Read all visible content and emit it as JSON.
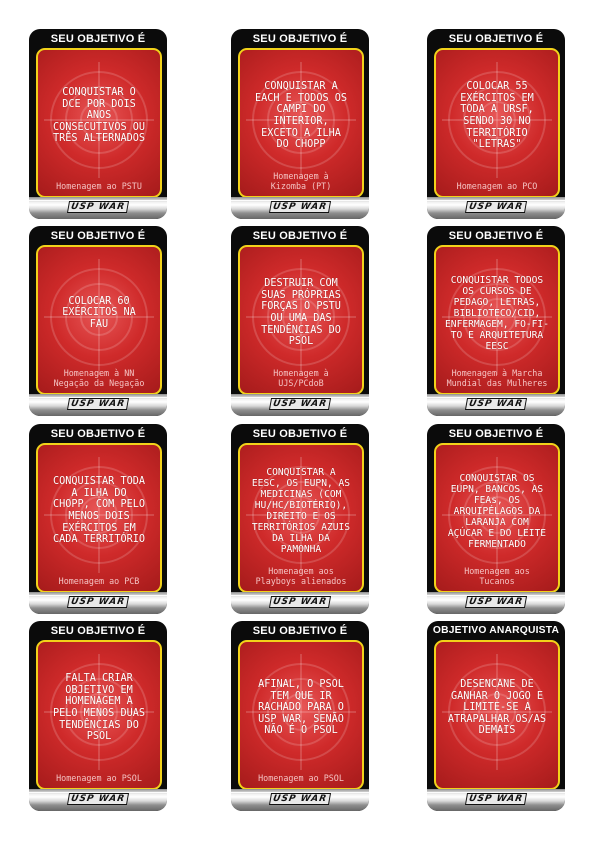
{
  "footer_logo": "USP WAR",
  "cards": [
    {
      "header": "SEU OBJETIVO É",
      "text": "CONQUISTAR O\nDCE POR DOIS\nANOS\nCONSECUTIVOS OU\nTRÊS ALTERNADOS",
      "credit": "Homenagem ao PSTU"
    },
    {
      "header": "SEU OBJETIVO É",
      "text": "CONQUISTAR A\nEACH E TODOS OS\nCAMPI DO\nINTERIOR,\nEXCETO A ILHA\nDO CHOPP",
      "credit": "Homenagem à\nKizomba (PT)"
    },
    {
      "header": "SEU OBJETIVO É",
      "text": "COLOCAR 55\nEXÉRCITOS EM\nTODA A URSF,\nSENDO 30 NO\nTERRITÓRIO\n\"LETRAS\"",
      "credit": "Homenagem ao PCO"
    },
    {
      "header": "SEU OBJETIVO É",
      "text": "COLOCAR 60\nEXÉRCITOS NA\nFAU",
      "credit": "Homenagem à NN\nNegação da Negação"
    },
    {
      "header": "SEU OBJETIVO É",
      "text": "DESTRUIR COM\nSUAS PRÓPRIAS\nFORÇAS O PSTU\nOU UMA DAS\nTENDÊNCIAS DO\nPSOL",
      "credit": "Homenagem à\nUJS/PCdoB"
    },
    {
      "header": "SEU OBJETIVO É",
      "text": "CONQUISTAR TODOS\nOS CURSOS DE\nPEDAGO, LETRAS,\nBIBLIOTECO/CID,\nENFERMAGEM, FO-FI-\nTO E ARQUITETURA\nEESC",
      "credit": "Homenagem à Marcha\nMundial das Mulheres"
    },
    {
      "header": "SEU OBJETIVO É",
      "text": "CONQUISTAR TODA\nA ILHA DO\nCHOPP, COM PELO\nMENOS DOIS\nEXÉRCITOS EM\nCADA TERRITÓRIO",
      "credit": "Homenagem ao PCB"
    },
    {
      "header": "SEU OBJETIVO É",
      "text": "CONQUISTAR A\nEESC, OS EUPN, AS\nMEDICINAS (COM\nHU/HC/BIOTÉRIO),\nDIREITO E OS\nTERRITÓRIOS AZUIS\nDA ILHA DA\nPAMONHA",
      "credit": "Homenagem aos\nPlayboys alienados"
    },
    {
      "header": "SEU OBJETIVO É",
      "text": "CONQUISTAR OS\nEUPN, BANCOS, AS\nFEAs, OS\nARQUIPÉLAGOS DA\nLARANJA COM\nAÇÚCAR E DO LEITE\nFERMENTADO",
      "credit": "Homenagem aos\nTucanos"
    },
    {
      "header": "SEU OBJETIVO É",
      "text": "FALTA CRIAR\nOBJETIVO EM\nHOMENAGEM A\nPELO MENOS DUAS\nTENDÊNCIAS DO\nPSOL",
      "credit": "Homenagem ao PSOL"
    },
    {
      "header": "SEU OBJETIVO É",
      "text": "AFINAL, O PSOL\nTEM QUE IR\nRACHADO PARA O\nUSP WAR, SENÃO\nNÃO É O PSOL",
      "credit": "Homenagem ao PSOL"
    },
    {
      "header": "OBJETIVO ANARQUISTA",
      "text": "DESENCANE DE\nGANHAR O JOGO E\nLIMITE-SE A\nATRAPALHAR OS/AS\nDEMAIS",
      "credit": ""
    }
  ]
}
